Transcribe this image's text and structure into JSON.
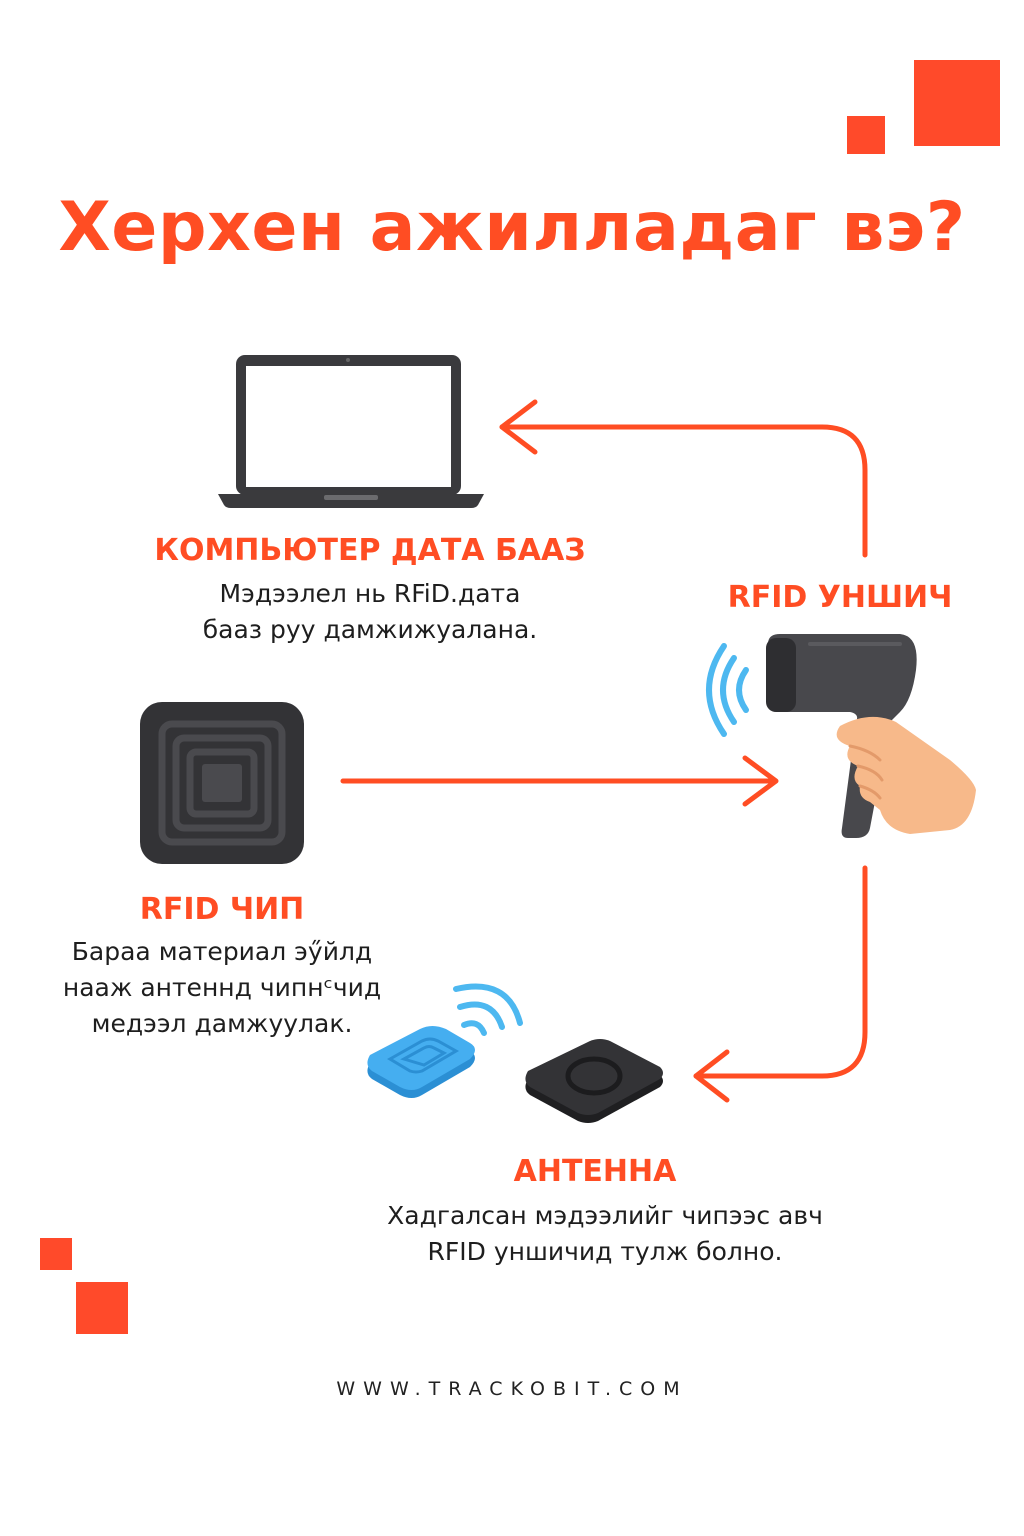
{
  "title": "Херхен ажилладаг вэ?",
  "colors": {
    "accent": "#ff4d23",
    "signal": "#4db8f0",
    "device": "#3a3a3d"
  },
  "nodes": {
    "computer": {
      "icon": "laptop-icon",
      "title": "КОМПЬЮТЕР ДАТА БААЗ",
      "desc": [
        "Мэдээлел нь RFiD.дата",
        "бааз руу дамжижуалана."
      ]
    },
    "reader": {
      "icon": "rfid-scanner-icon",
      "title": "RFID УНШИЧ"
    },
    "chip": {
      "icon": "rfid-chip-icon",
      "title": "RFID ЧИП",
      "desc": [
        "Бараа материал эӳйлд",
        "нааж антеннд чипнᶜчид",
        "медээл дамжуулак."
      ]
    },
    "antenna": {
      "icon": "antenna-icon",
      "title": "АНТЕННА",
      "desc": [
        "Хадгалсан мэдээлийг чипээс авч",
        "RFID уншичид тулж   болно."
      ]
    }
  },
  "footer": "WWW.TRACKOBIT.COM"
}
